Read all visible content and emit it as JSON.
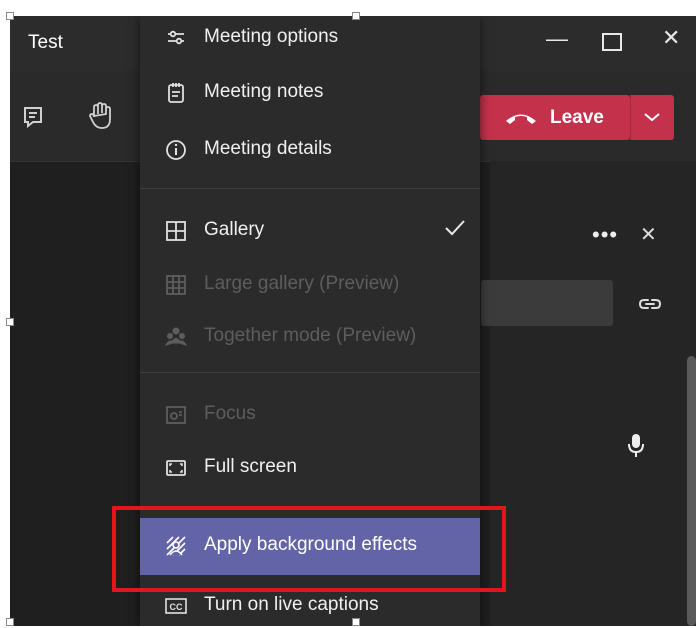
{
  "window": {
    "title": "Test"
  },
  "titlebar": {
    "minimize_icon": "minimize-icon",
    "maximize_icon": "maximize-icon",
    "close_icon": "close-icon"
  },
  "toolbar": {
    "chat_icon": "chat-icon",
    "raise_hand_icon": "raise-hand-icon",
    "leave_label": "Leave"
  },
  "menu": {
    "items": [
      {
        "label": "Meeting options",
        "icon": "options-icon",
        "enabled": true
      },
      {
        "label": "Meeting notes",
        "icon": "notes-icon",
        "enabled": true
      },
      {
        "label": "Meeting details",
        "icon": "info-icon",
        "enabled": true
      },
      {
        "label": "Gallery",
        "icon": "gallery-icon",
        "enabled": true,
        "checked": true
      },
      {
        "label": "Large gallery (Preview)",
        "icon": "large-gallery-icon",
        "enabled": false
      },
      {
        "label": "Together mode (Preview)",
        "icon": "together-mode-icon",
        "enabled": false
      },
      {
        "label": "Focus",
        "icon": "focus-icon",
        "enabled": false
      },
      {
        "label": "Full screen",
        "icon": "fullscreen-icon",
        "enabled": true
      },
      {
        "label": "Apply background effects",
        "icon": "background-effects-icon",
        "enabled": true,
        "highlighted": true
      },
      {
        "label": "Turn on live captions",
        "icon": "captions-icon",
        "enabled": true
      }
    ]
  },
  "side_panel": {
    "more_icon": "more-icon",
    "close_icon": "close-icon",
    "link_icon": "link-icon",
    "mic_icon": "mic-icon"
  },
  "colors": {
    "highlight": "#6264a7",
    "leave_button": "#c4314b",
    "annotation_box": "#e3161b"
  }
}
